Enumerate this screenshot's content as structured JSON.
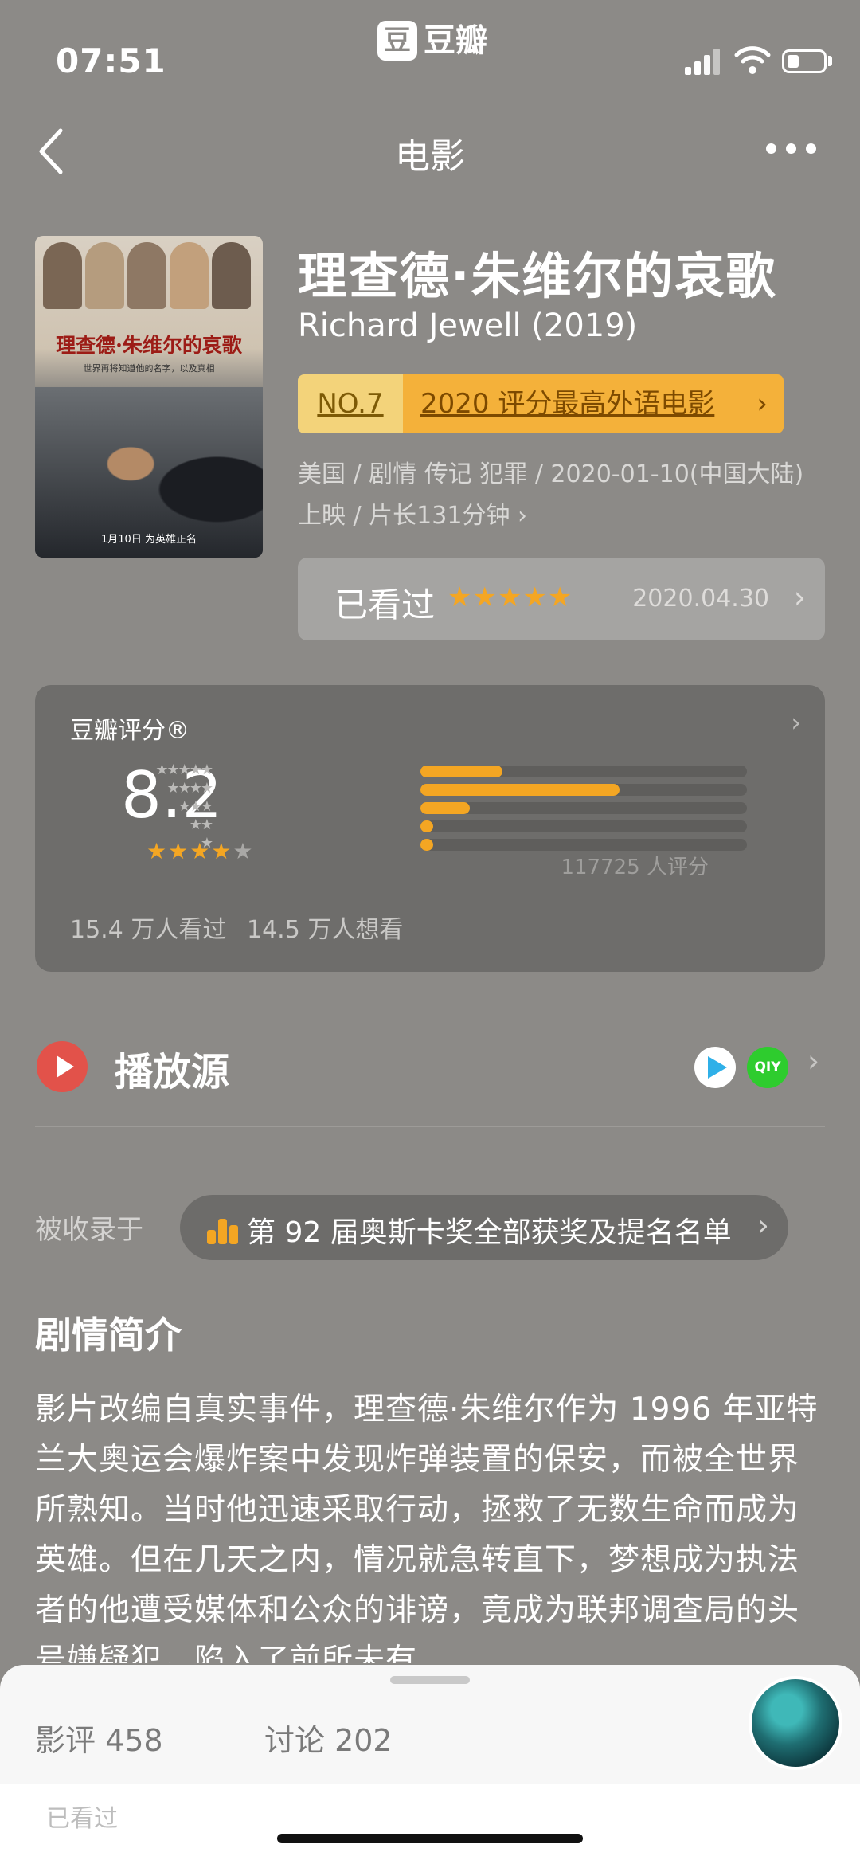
{
  "status_bar": {
    "time": "07:51",
    "app_badge": "豆",
    "app_name": "豆瓣"
  },
  "nav": {
    "title": "电影"
  },
  "movie": {
    "title": "理查德·朱维尔的哀歌",
    "original_title": "Richard Jewell (2019)",
    "rank_no": "NO.7",
    "rank_label": "2020 评分最高外语电影",
    "meta": "美国 / 剧情 传记 犯罪 / 2020-01-10(中国大陆) 上映 / 片长131分钟 ›",
    "poster": {
      "title": "理查德·朱维尔的哀歌",
      "tagline": "世界再将知道他的名字，以及真相",
      "release_note": "1月10日 为英雄正名"
    }
  },
  "watched": {
    "label": "已看过",
    "stars": "★★★★★",
    "date": "2020.04.30"
  },
  "rating": {
    "title": "豆瓣评分®",
    "score": "8.2",
    "stars_on": "★★★★",
    "stars_off": "★",
    "distribution": [
      {
        "stars": "★★★★★",
        "percent": 25
      },
      {
        "stars": "★★★★",
        "percent": 61
      },
      {
        "stars": "★★★",
        "percent": 15
      },
      {
        "stars": "★★",
        "percent": 4
      },
      {
        "stars": "★",
        "percent": 4
      }
    ],
    "count": "117725 人评分",
    "seen": "15.4 万人看过",
    "want": "14.5 万人想看"
  },
  "play": {
    "label": "播放源",
    "source2_text": "QIY"
  },
  "collection": {
    "label": "被收录于",
    "name": "第 92 届奥斯卡奖全部获奖及提名名单"
  },
  "synopsis": {
    "title": "剧情简介",
    "text": "影片改编自真实事件，理查德·朱维尔作为 1996 年亚特兰大奥运会爆炸案中发现炸弹装置的保安，而被全世界所熟知。当时他迅速采取行动，拯救了无数生命而成为英雄。但在几天之内，情况就急转直下，梦想成为执法者的他遭受媒体和公众的诽谤，竟成为联邦调查局的头号嫌疑犯，陷入了前所未有"
  },
  "bottom_sheet": {
    "tab_reviews": "影评 458",
    "tab_discussion": "讨论 202",
    "hint": "已看过"
  },
  "colors": {
    "accent": "#f4a623",
    "background": "#8c8a87",
    "card": "#6e6d6b",
    "play_red": "#e2524a",
    "iqiyi_green": "#2ecc2e"
  }
}
